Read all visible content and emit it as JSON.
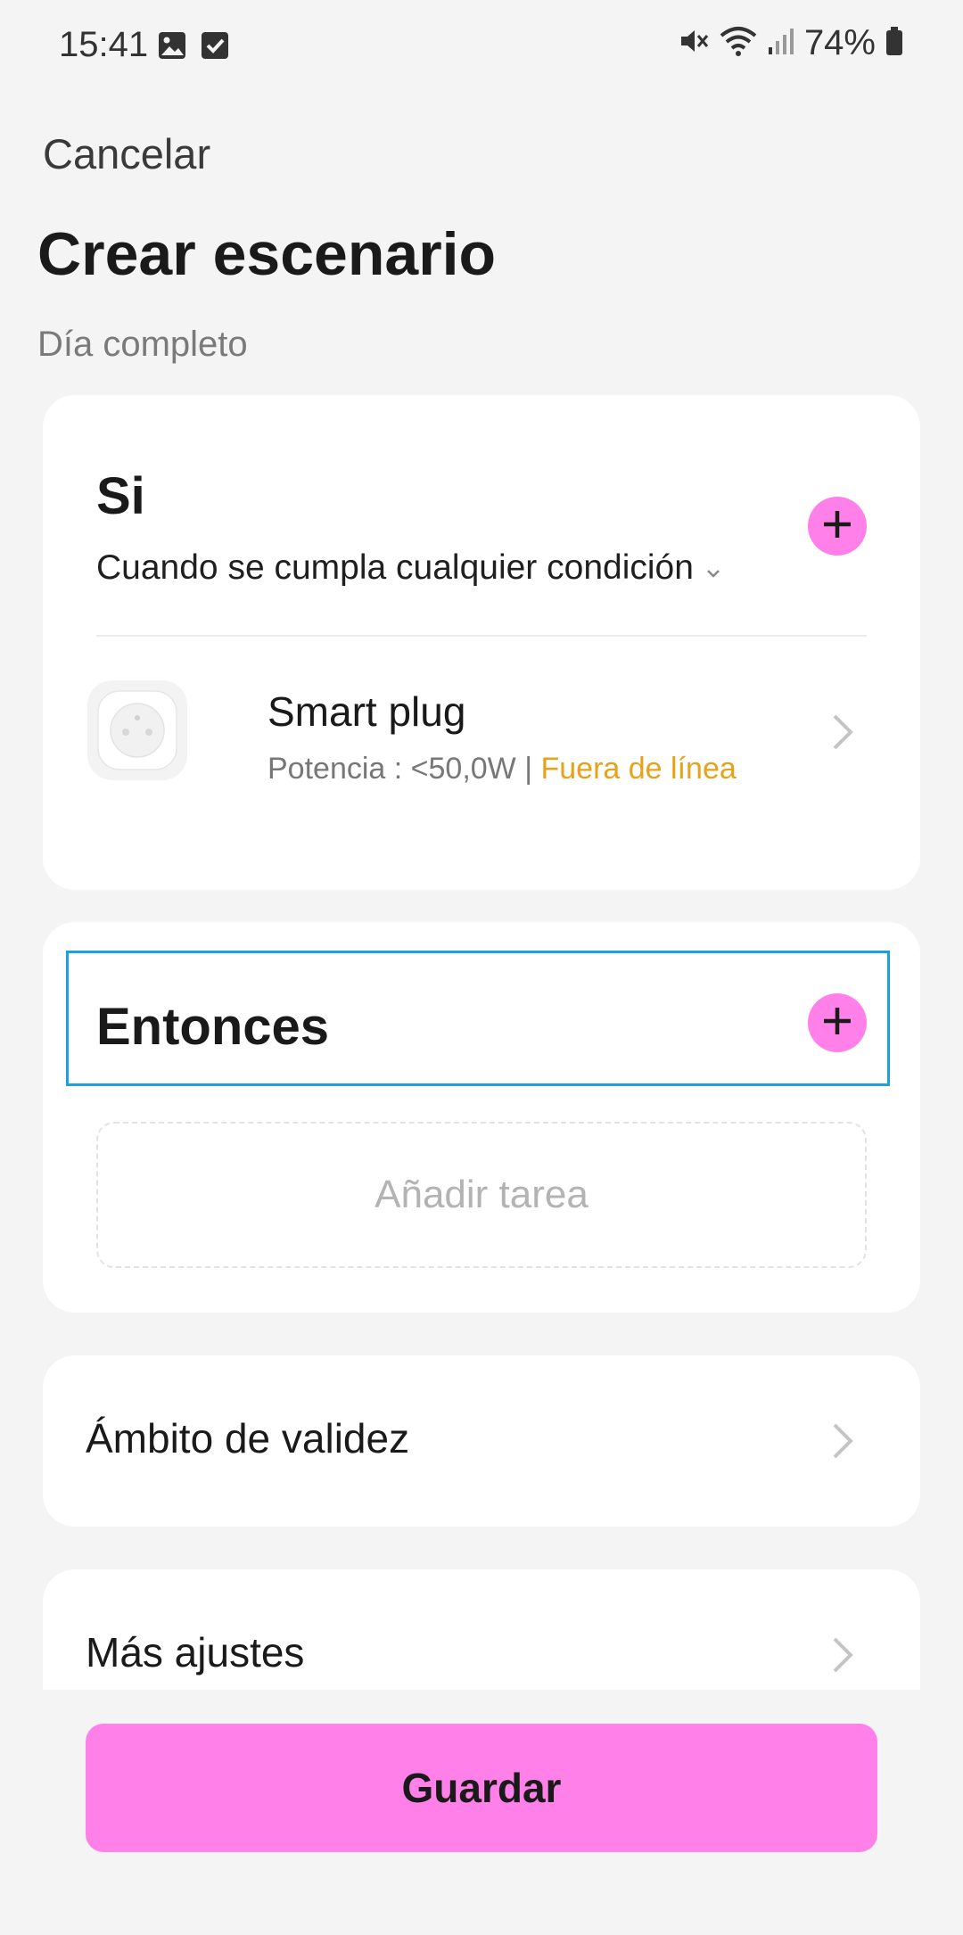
{
  "status_bar": {
    "time": "15:41",
    "battery": "74%",
    "icons": [
      "image-icon",
      "check-square-icon",
      "mute-icon",
      "wifi-icon",
      "signal-icon",
      "battery-icon"
    ]
  },
  "header": {
    "cancel_label": "Cancelar",
    "title": "Crear escenario",
    "subtitle": "Día completo"
  },
  "if_section": {
    "title": "Si",
    "condition": "Cuando se cumpla cualquier condición",
    "add_icon": "plus-icon",
    "conditions": [
      {
        "name": "Smart plug",
        "detail": "Potencia : <50,0W | ",
        "status": "Fuera de línea",
        "icon": "smart-plug-icon"
      }
    ]
  },
  "then_section": {
    "title": "Entonces",
    "add_task_label": "Añadir tarea",
    "add_icon": "plus-icon"
  },
  "validity": {
    "label": "Ámbito de validez"
  },
  "more_settings": {
    "label": "Más ajustes"
  },
  "save_label": "Guardar",
  "colors": {
    "accent": "#ff80e8",
    "offline": "#e8a21a",
    "focus_border": "#1ea0e0"
  }
}
